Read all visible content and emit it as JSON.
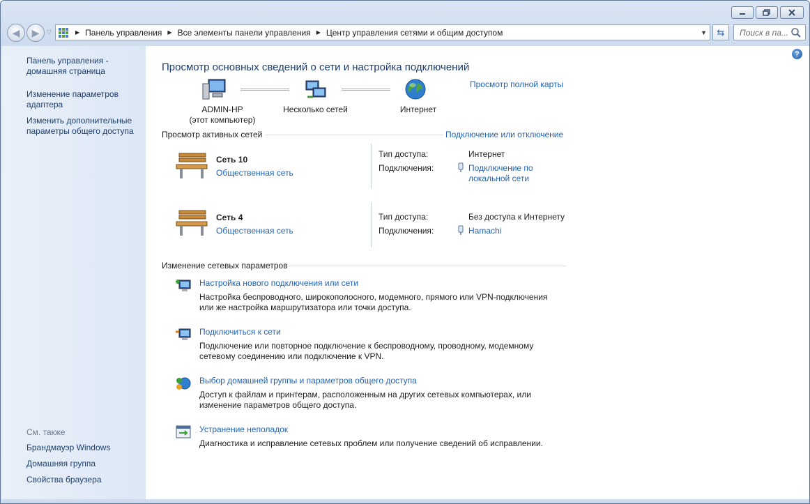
{
  "window": {
    "minimize_label": "minimize",
    "maximize_label": "maximize",
    "close_label": "close"
  },
  "address": {
    "breadcrumbs": [
      "Панель управления",
      "Все элементы панели управления",
      "Центр управления сетями и общим доступом"
    ],
    "search_placeholder": "Поиск в па..."
  },
  "sidebar": {
    "links": [
      {
        "label1": "Панель управления -",
        "label2": "домашняя страница"
      },
      {
        "label1": "Изменение параметров",
        "label2": "адаптера"
      },
      {
        "label1": "Изменить дополнительные",
        "label2": "параметры общего доступа"
      }
    ],
    "see_also": "См. также",
    "see_also_links": [
      "Брандмауэр Windows",
      "Домашняя группа",
      "Свойства браузера"
    ]
  },
  "main": {
    "title": "Просмотр основных сведений о сети и настройка подключений",
    "full_map_link": "Просмотр полной карты",
    "map": {
      "computer_name": "ADMIN-HP",
      "computer_sub": "(этот компьютер)",
      "networks": "Несколько сетей",
      "internet": "Интернет"
    },
    "active_networks_label": "Просмотр активных сетей",
    "connect_disconnect": "Подключение или отключение",
    "networks": [
      {
        "name": "Сеть  10",
        "type": "Общественная сеть",
        "access_label": "Тип доступа:",
        "access_value": "Интернет",
        "conn_label": "Подключения:",
        "conn_value1": "Подключение по",
        "conn_value2": "локальной сети"
      },
      {
        "name": "Сеть  4",
        "type": "Общественная сеть",
        "access_label": "Тип доступа:",
        "access_value": "Без доступа к Интернету",
        "conn_label": "Подключения:",
        "conn_value1": "Hamachi",
        "conn_value2": ""
      }
    ],
    "change_settings_label": "Изменение сетевых параметров",
    "tasks": [
      {
        "title": "Настройка нового подключения или сети",
        "desc1": "Настройка беспроводного, широкополосного, модемного, прямого или VPN-подключения",
        "desc2": "или же настройка маршрутизатора или точки доступа."
      },
      {
        "title": "Подключиться к сети",
        "desc1": "Подключение или повторное подключение к беспроводному, проводному, модемному",
        "desc2": "сетевому соединению или подключение к VPN."
      },
      {
        "title": "Выбор домашней группы и параметров общего доступа",
        "desc1": "Доступ к файлам и принтерам, расположенным на других сетевых компьютерах, или",
        "desc2": "изменение параметров общего доступа."
      },
      {
        "title": "Устранение неполадок",
        "desc1": "Диагностика и исправление сетевых проблем или получение сведений об исправлении.",
        "desc2": ""
      }
    ]
  }
}
